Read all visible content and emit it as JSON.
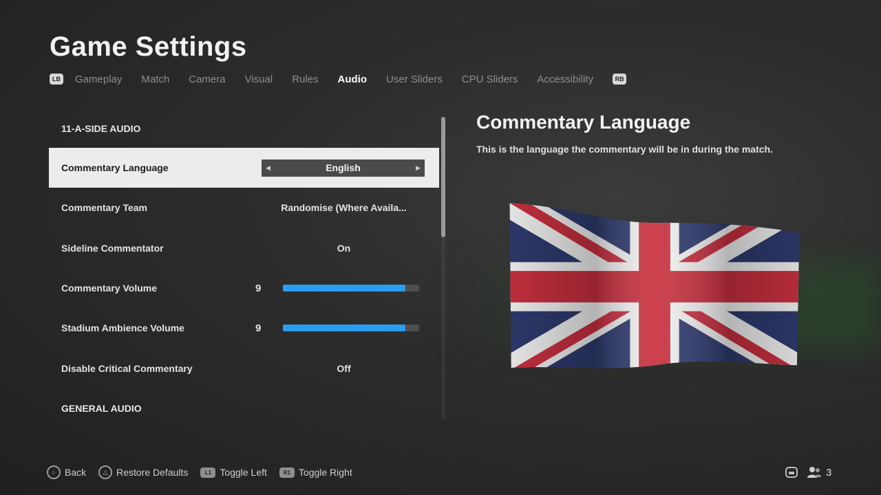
{
  "page_title": "Game Settings",
  "tabs": {
    "left_bumper": "LB",
    "right_bumper": "RB",
    "items": [
      "Gameplay",
      "Match",
      "Camera",
      "Visual",
      "Rules",
      "Audio",
      "User Sliders",
      "CPU Sliders",
      "Accessibility"
    ],
    "active": "Audio"
  },
  "settings": {
    "section_1": "11-A-SIDE AUDIO",
    "section_2": "GENERAL AUDIO",
    "commentary_language": {
      "label": "Commentary Language",
      "value": "English"
    },
    "commentary_team": {
      "label": "Commentary Team",
      "value": "Randomise (Where Availa..."
    },
    "sideline_commentator": {
      "label": "Sideline Commentator",
      "value": "On"
    },
    "commentary_volume": {
      "label": "Commentary Volume",
      "value": "9",
      "level": 0.9
    },
    "stadium_volume": {
      "label": "Stadium Ambience Volume",
      "value": "9",
      "level": 0.9
    },
    "disable_critical": {
      "label": "Disable Critical Commentary",
      "value": "Off"
    }
  },
  "detail": {
    "title": "Commentary Language",
    "description": "This is the language the commentary will be in during the match.",
    "image": "union-jack-flag"
  },
  "footer": {
    "back": "Back",
    "restore": "Restore Defaults",
    "toggle_left": "Toggle Left",
    "toggle_right": "Toggle Right",
    "player_count": "3"
  },
  "colors": {
    "accent": "#2b9df0",
    "selected_row": "#ececec"
  }
}
